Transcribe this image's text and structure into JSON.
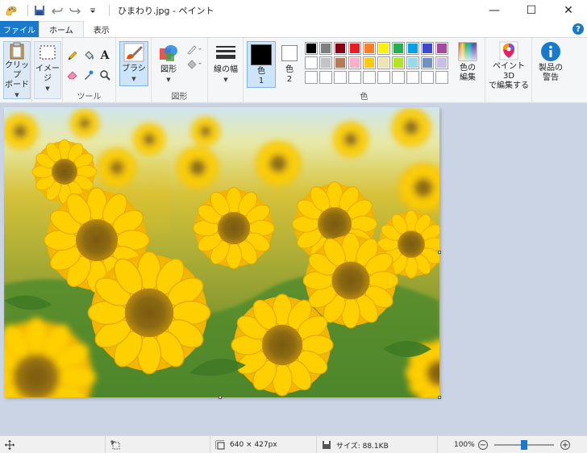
{
  "window": {
    "title": "ひまわり.jpg - ペイント",
    "minimize_glyph": "—",
    "maximize_glyph": "☐",
    "close_glyph": "✕"
  },
  "quick_access": {
    "save_icon": "save-icon",
    "undo_icon": "undo-icon",
    "redo_icon": "redo-icon",
    "customize_icon": "chevron-down-icon"
  },
  "tabs": {
    "file": "ファイル",
    "home": "ホーム",
    "view": "表示"
  },
  "ribbon": {
    "clipboard": {
      "label_line1": "クリップ",
      "label_line2": "ボード"
    },
    "image": {
      "label": "イメージ"
    },
    "tools": {
      "group_label": "ツール"
    },
    "brush": {
      "label": "ブラシ"
    },
    "shapes": {
      "label": "図形",
      "group_label": "図形"
    },
    "stroke": {
      "label": "線の幅"
    },
    "color1": {
      "label_line1": "色",
      "label_line2": "1",
      "color": "#000000"
    },
    "color2": {
      "label_line1": "色",
      "label_line2": "2",
      "color": "#ffffff"
    },
    "colors_group_label": "色",
    "edit_colors": {
      "label_line1": "色の",
      "label_line2": "編集"
    },
    "paint3d": {
      "label_line1": "ペイント 3D",
      "label_line2": "で編集する"
    },
    "product_alert": {
      "label_line1": "製品の",
      "label_line2": "警告"
    }
  },
  "palette": {
    "row1": [
      "#000000",
      "#7f7f7f",
      "#880015",
      "#ed1c24",
      "#ff7f27",
      "#fff200",
      "#22b14c",
      "#00a2e8",
      "#3f48cc",
      "#a349a4"
    ],
    "row2": [
      "#ffffff",
      "#c3c3c3",
      "#b97a57",
      "#ffaec9",
      "#ffc90e",
      "#efe4b0",
      "#b5e61d",
      "#99d9ea",
      "#7092be",
      "#c8bfe7"
    ],
    "row3": [
      "#ffffff",
      "#ffffff",
      "#ffffff",
      "#ffffff",
      "#ffffff",
      "#ffffff",
      "#ffffff",
      "#ffffff",
      "#ffffff",
      "#ffffff"
    ]
  },
  "status": {
    "dimensions": "640 × 427px",
    "size": "サイズ: 88.1KB",
    "zoom": "100%",
    "zoom_minus": "−",
    "zoom_plus": "+",
    "zoom_level_fraction": 0.5
  }
}
